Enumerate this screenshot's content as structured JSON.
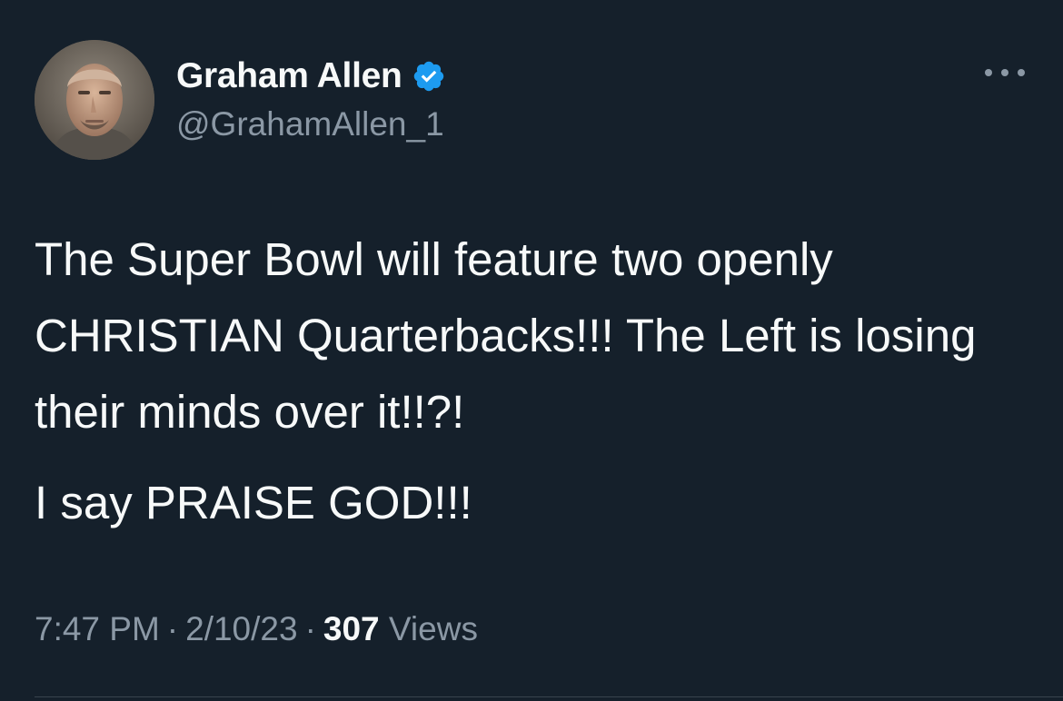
{
  "author": {
    "display_name": "Graham Allen",
    "handle": "@GrahamAllen_1",
    "verified_icon": "verified-badge-icon",
    "badge_color": "#1d9bf0"
  },
  "tweet": {
    "paragraphs": [
      "The Super Bowl will feature two openly CHRISTIAN Quarterbacks!!! The Left is losing their minds over it!!?!",
      "I say PRAISE GOD!!!"
    ]
  },
  "meta": {
    "time": "7:47 PM",
    "separator": "·",
    "date": "2/10/23",
    "views_count": "307",
    "views_label": "Views"
  },
  "theme": {
    "background": "#15202b",
    "text": "#f7f9f9",
    "secondary_text": "#8b98a5",
    "accent": "#1d9bf0"
  },
  "icons": {
    "more": "more-horizontal-icon"
  }
}
